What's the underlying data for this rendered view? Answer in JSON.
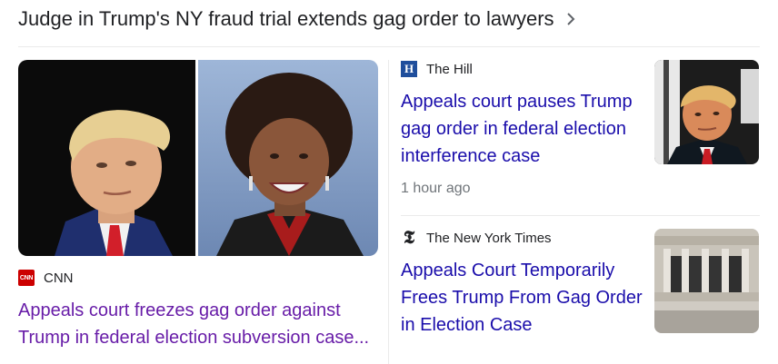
{
  "header": {
    "title": "Judge in Trump's NY fraud trial extends gag order to lawyers",
    "chevron_icon": "chevron-right-icon"
  },
  "left_card": {
    "source": "CNN",
    "source_logo_text": "CNN",
    "headline": "Appeals court freezes gag order against Trump in federal election subversion case...",
    "headline_color": "#681da8"
  },
  "right_items": [
    {
      "source": "The Hill",
      "source_logo_text": "H",
      "headline": "Appeals court pauses Trump gag order in federal election interference case",
      "time": "1 hour ago",
      "headline_color": "#1a0dab"
    },
    {
      "source": "The New York Times",
      "source_logo_text": "𝕿",
      "headline": "Appeals Court Temporarily Frees Trump From Gag Order in Election Case",
      "headline_color": "#1a0dab"
    }
  ]
}
